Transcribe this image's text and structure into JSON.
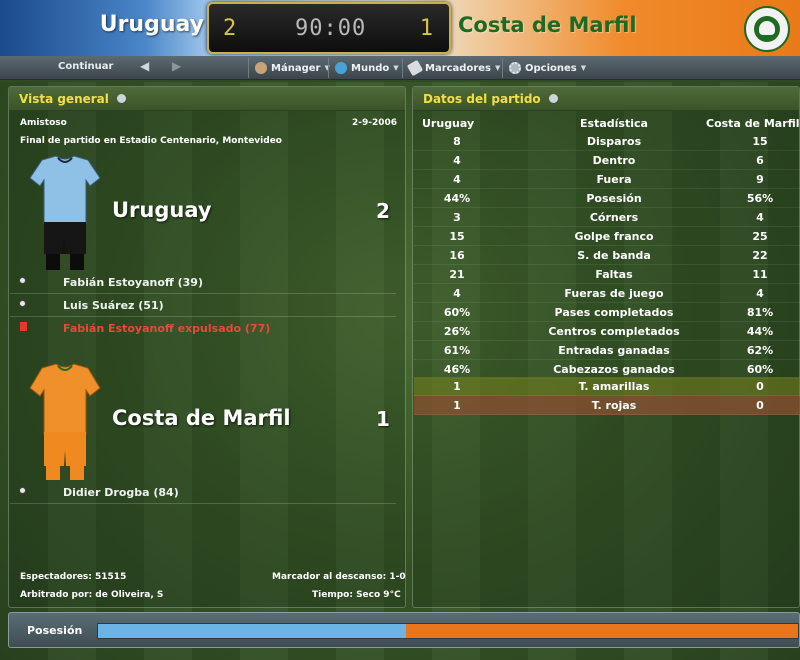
{
  "header": {
    "home_team": "Uruguay",
    "away_team": "Costa de Marfil",
    "home_score": "2",
    "away_score": "1",
    "match_time": "90:00"
  },
  "toolbar": {
    "continue_label": "Continuar",
    "back_icon": "arrow-left-icon",
    "forward_icon": "arrow-right-icon",
    "buttons": [
      {
        "label": "Mánager",
        "icon": "manager-icon"
      },
      {
        "label": "Mundo",
        "icon": "globe-icon"
      },
      {
        "label": "Marcadores",
        "icon": "bookmark-icon"
      },
      {
        "label": "Opciones",
        "icon": "gears-icon"
      }
    ]
  },
  "overview": {
    "title": "Vista general",
    "match_type": "Amistoso",
    "date": "2-9-2006",
    "venue_text": "Final de partido en Estadio Centenario, Montevideo",
    "home": {
      "team": "Uruguay",
      "score": "2",
      "events": [
        {
          "type": "goal",
          "text": "Fabián Estoyanoff (39)"
        },
        {
          "type": "goal",
          "text": "Luis Suárez (51)"
        },
        {
          "type": "red-card",
          "text": "Fabián Estoyanoff expulsado (77)"
        }
      ]
    },
    "away": {
      "team": "Costa de Marfil",
      "score": "1",
      "events": [
        {
          "type": "goal",
          "text": "Didier Drogba (84)"
        }
      ]
    },
    "attendance": "Espectadores: 51515",
    "halftime": "Marcador al descanso: 1-0",
    "referee": "Arbitrado por: de Oliveira, S",
    "weather": "Tiempo: Seco 9°C"
  },
  "match_stats": {
    "title": "Datos del partido",
    "headers": [
      "Uruguay",
      "Estadística",
      "Costa de Marfil"
    ],
    "rows": [
      [
        "8",
        "Disparos",
        "15"
      ],
      [
        "4",
        "Dentro",
        "6"
      ],
      [
        "4",
        "Fuera",
        "9"
      ],
      [
        "44%",
        "Posesión",
        "56%"
      ],
      [
        "3",
        "Córners",
        "4"
      ],
      [
        "15",
        "Golpe franco",
        "25"
      ],
      [
        "16",
        "S. de banda",
        "22"
      ],
      [
        "21",
        "Faltas",
        "11"
      ],
      [
        "4",
        "Fueras de juego",
        "4"
      ],
      [
        "60%",
        "Pases completados",
        "81%"
      ],
      [
        "26%",
        "Centros completados",
        "44%"
      ],
      [
        "61%",
        "Entradas ganadas",
        "62%"
      ],
      [
        "46%",
        "Cabezazos ganados",
        "60%"
      ],
      [
        "1",
        "T. amarillas",
        "0"
      ],
      [
        "1",
        "T. rojas",
        "0"
      ]
    ]
  },
  "possession_bar": {
    "label": "Posesión",
    "home_fraction": 0.44,
    "home_color": "#6db4e6",
    "away_color": "#e9761a"
  },
  "colors": {
    "accent_yellow": "#f2e040",
    "away_green": "#1e6a22",
    "red_card": "#e23b2e"
  }
}
